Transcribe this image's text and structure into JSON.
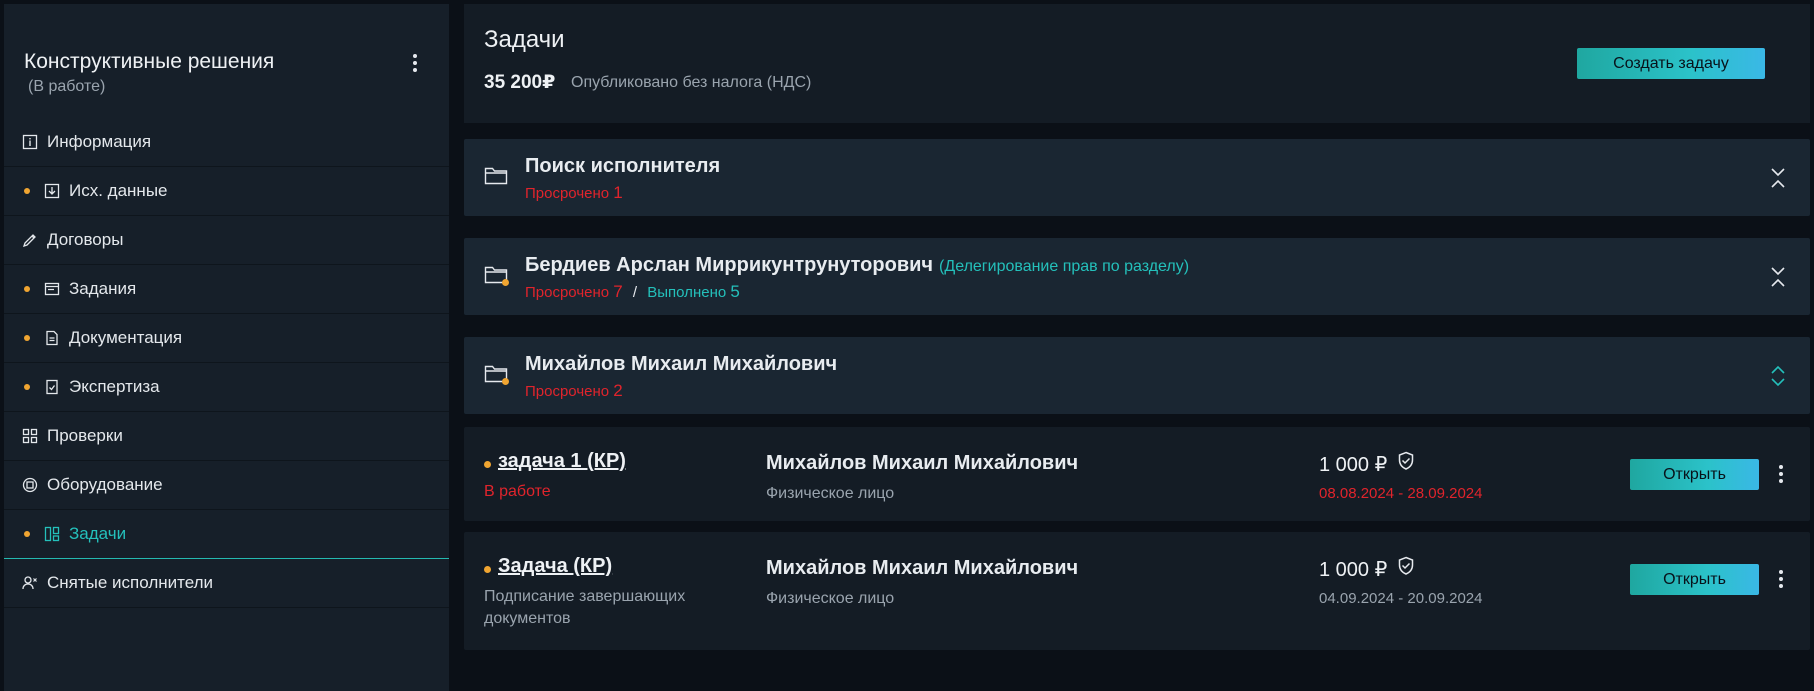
{
  "project": {
    "title": "Конструктивные решения",
    "status": "(В работе)"
  },
  "sidebar": {
    "items": [
      {
        "label": "Информация",
        "icon": "info-icon",
        "dot": false
      },
      {
        "label": "Исх. данные",
        "icon": "download-icon",
        "dot": true
      },
      {
        "label": "Договоры",
        "icon": "pen-icon",
        "dot": false
      },
      {
        "label": "Задания",
        "icon": "window-icon",
        "dot": true
      },
      {
        "label": "Документация",
        "icon": "document-icon",
        "dot": true
      },
      {
        "label": "Экспертиза",
        "icon": "checklist-icon",
        "dot": true
      },
      {
        "label": "Проверки",
        "icon": "grid-icon",
        "dot": false
      },
      {
        "label": "Оборудование",
        "icon": "chip-icon",
        "dot": false
      },
      {
        "label": "Задачи",
        "icon": "board-icon",
        "dot": true,
        "active": true
      },
      {
        "label": "Снятые исполнители",
        "icon": "user-remove-icon",
        "dot": false
      }
    ]
  },
  "header": {
    "title": "Задачи",
    "sum": "35 200₽",
    "sum_note": "Опубликовано без налога (НДС)",
    "create_label": "Создать задачу"
  },
  "groups": [
    {
      "name": "Поиск исполнителя",
      "role": "",
      "overdue_label": "Просрочено",
      "overdue_count": "1",
      "done_label": "",
      "done_count": "",
      "expanded": false
    },
    {
      "name": "Бердиев Арслан Миррикунтрунуторович",
      "role": "(Делегирование прав по разделу)",
      "overdue_label": "Просрочено",
      "overdue_count": "7",
      "separator": "/",
      "done_label": "Выполнено",
      "done_count": "5",
      "expanded": false
    },
    {
      "name": "Михайлов Михаил Михайлович",
      "role": "",
      "overdue_label": "Просрочено",
      "overdue_count": "2",
      "done_label": "",
      "done_count": "",
      "expanded": true
    }
  ],
  "tasks": [
    {
      "name": "задача 1 (КР)",
      "status": "В работе",
      "person": "Михайлов Михаил Михайлович",
      "person_type": "Физическое лицо",
      "price": "1 000 ₽",
      "dates": "08.08.2024 - 28.09.2024",
      "open_label": "Открыть"
    },
    {
      "name": "Задача (КР)",
      "status": "Подписание завершающих документов",
      "person": "Михайлов Михаил Михайлович",
      "person_type": "Физическое лицо",
      "price": "1 000 ₽",
      "dates": "04.09.2024 - 20.09.2024",
      "open_label": "Открыть"
    }
  ],
  "colors": {
    "accent": "#24c0bb",
    "danger": "#e0242c",
    "warning_dot": "#f0a531",
    "background": "#0b1017",
    "panel": "#161f29",
    "group": "#1a2632"
  }
}
